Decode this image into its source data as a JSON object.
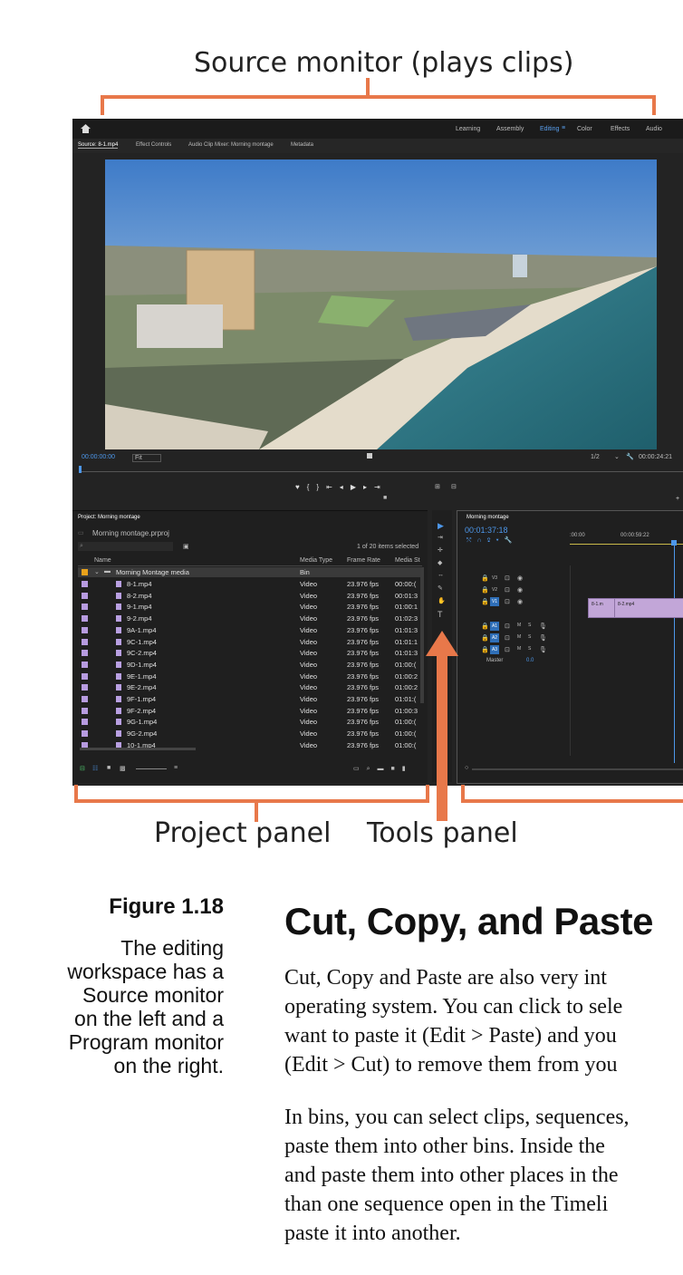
{
  "callouts": {
    "source_monitor": "Source monitor (plays clips)",
    "project_panel": "Project panel",
    "tools_panel": "Tools panel"
  },
  "app": {
    "workspaces": [
      "Learning",
      "Assembly",
      "Editing",
      "Color",
      "Effects",
      "Audio"
    ],
    "active_workspace": "Editing",
    "source_tabs": [
      "Source: 8-1.mp4",
      "Effect Controls",
      "Audio Clip Mixer: Morning montage",
      "Metadata"
    ],
    "source_timecode": "00:00:00:00",
    "fit_label": "Fit",
    "resolution": "1/2",
    "duration": "00:00:24:21",
    "project": {
      "panel_title": "Project: Morning montage",
      "file_name": "Morning montage.prproj",
      "items_selected": "1 of 20 items selected",
      "columns": [
        "Name",
        "Media Type",
        "Frame Rate",
        "Media St"
      ],
      "bin": {
        "name": "Morning Montage media",
        "type": "Bin"
      },
      "rows": [
        {
          "name": "8-1.mp4",
          "type": "Video",
          "rate": "23.976 fps",
          "start": "00:00:("
        },
        {
          "name": "8-2.mp4",
          "type": "Video",
          "rate": "23.976 fps",
          "start": "00:01:3"
        },
        {
          "name": "9-1.mp4",
          "type": "Video",
          "rate": "23.976 fps",
          "start": "01:00:1"
        },
        {
          "name": "9-2.mp4",
          "type": "Video",
          "rate": "23.976 fps",
          "start": "01:02:3"
        },
        {
          "name": "9A-1.mp4",
          "type": "Video",
          "rate": "23.976 fps",
          "start": "01:01:3"
        },
        {
          "name": "9C-1.mp4",
          "type": "Video",
          "rate": "23.976 fps",
          "start": "01:01:1"
        },
        {
          "name": "9C-2.mp4",
          "type": "Video",
          "rate": "23.976 fps",
          "start": "01:01:3"
        },
        {
          "name": "9D-1.mp4",
          "type": "Video",
          "rate": "23.976 fps",
          "start": "01:00:("
        },
        {
          "name": "9E-1.mp4",
          "type": "Video",
          "rate": "23.976 fps",
          "start": "01:00:2"
        },
        {
          "name": "9E-2.mp4",
          "type": "Video",
          "rate": "23.976 fps",
          "start": "01:00:2"
        },
        {
          "name": "9F-1.mp4",
          "type": "Video",
          "rate": "23.976 fps",
          "start": "01:01:("
        },
        {
          "name": "9F-2.mp4",
          "type": "Video",
          "rate": "23.976 fps",
          "start": "01:00:3"
        },
        {
          "name": "9G-1.mp4",
          "type": "Video",
          "rate": "23.976 fps",
          "start": "01:00:("
        },
        {
          "name": "9G-2.mp4",
          "type": "Video",
          "rate": "23.976 fps",
          "start": "01:00:("
        },
        {
          "name": "10-1.mp4",
          "type": "Video",
          "rate": "23.976 fps",
          "start": "01:00:("
        }
      ]
    },
    "timeline": {
      "tab": "Morning montage",
      "timecode": "00:01:37:18",
      "ruler": [
        ":00:00",
        "00:00:59:22"
      ],
      "video_tracks": [
        "V3",
        "V2",
        "V1"
      ],
      "audio_tracks": [
        "A1",
        "A2",
        "A3"
      ],
      "master_label": "Master",
      "master_value": "0.0",
      "clip_labels": [
        "8-1.m",
        "8-2.mp4"
      ]
    }
  },
  "figure": {
    "label": "Figure 1.18",
    "caption_lines": [
      "The editing",
      "workspace has a",
      "Source monitor",
      "on the left and a",
      "Program monitor",
      "on the right."
    ]
  },
  "article": {
    "heading": "Cut, Copy, and Paste",
    "para1": [
      "Cut, Copy and Paste are also very int",
      "operating system. You can click to sele",
      "want to paste it (Edit > Paste) and you",
      "(Edit > Cut) to remove them from you"
    ],
    "para2": [
      "In bins, you can select clips, sequences,",
      "paste them into other bins. Inside the",
      "and paste them into other places in the",
      "than one sequence open in the Timeli",
      "paste it into another."
    ]
  },
  "colors": {
    "accent_orange": "#e8784a",
    "app_bg": "#232323",
    "premiere_blue": "#2f8ee0",
    "clip_violet": "#c2a6d8"
  }
}
